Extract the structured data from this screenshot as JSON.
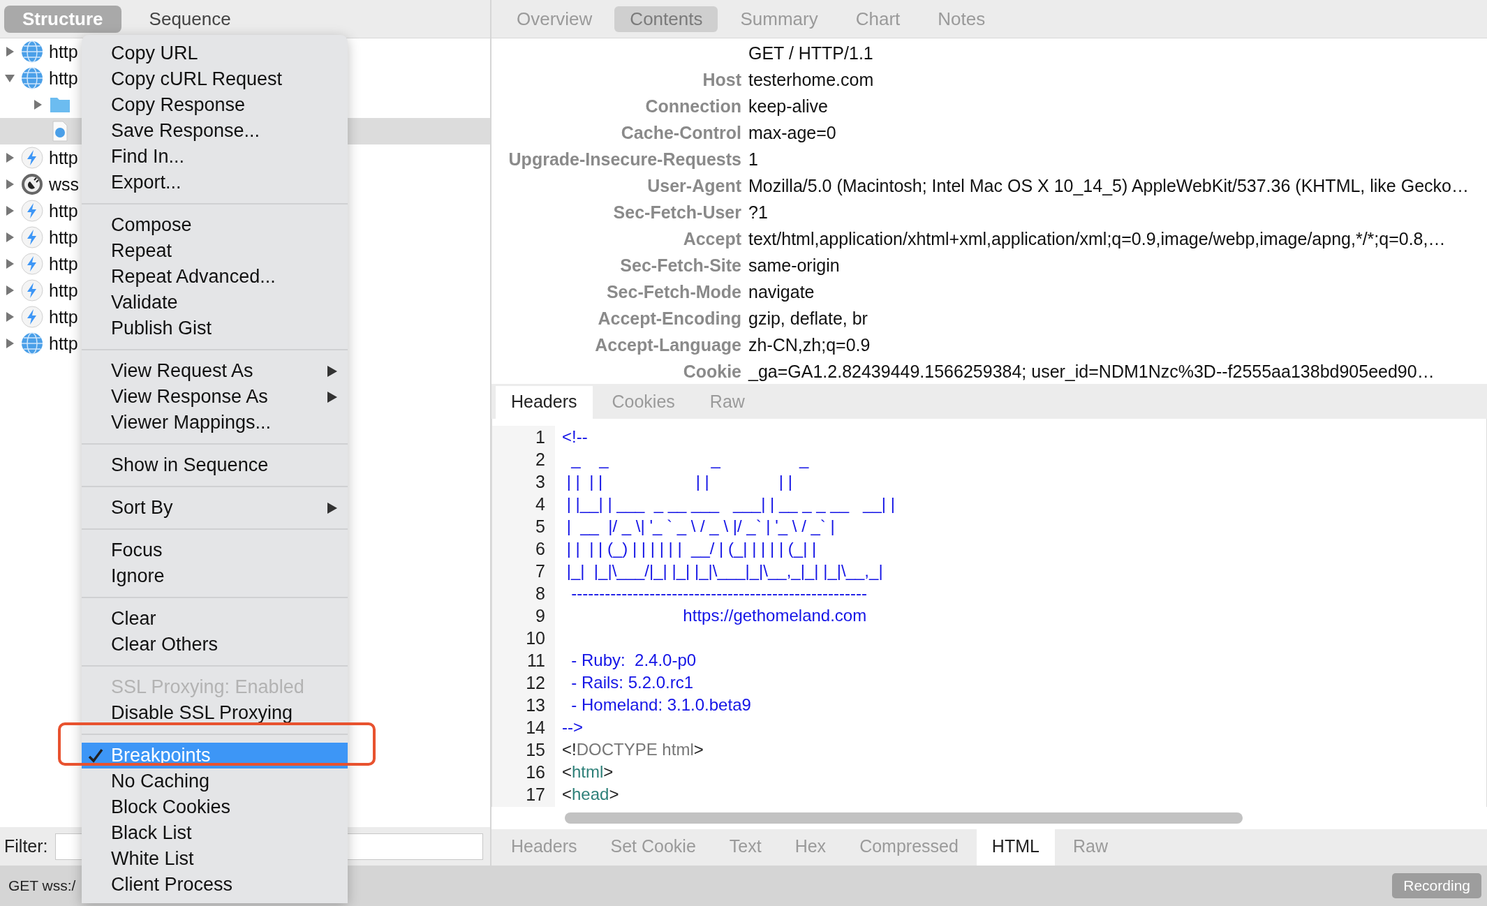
{
  "left_tabs": [
    {
      "label": "Structure",
      "selected": true
    },
    {
      "label": "Sequence",
      "selected": false
    }
  ],
  "tree": [
    {
      "kind": "globe",
      "label": "http",
      "expanded": false,
      "selected": false
    },
    {
      "kind": "globe",
      "label": "http",
      "expanded": true,
      "selected": false,
      "children": [
        {
          "kind": "folder",
          "expanded": false,
          "selected": false
        },
        {
          "kind": "document",
          "selected": true
        }
      ]
    },
    {
      "kind": "bolt",
      "label": "http",
      "expanded": false,
      "selected": false
    },
    {
      "kind": "socket",
      "label": "wss",
      "expanded": false,
      "selected": false
    },
    {
      "kind": "bolt",
      "label": "http",
      "expanded": false,
      "selected": false
    },
    {
      "kind": "bolt",
      "label": "http",
      "expanded": false,
      "selected": false
    },
    {
      "kind": "bolt",
      "label": "http",
      "expanded": false,
      "selected": false
    },
    {
      "kind": "bolt",
      "label": "http",
      "expanded": false,
      "selected": false
    },
    {
      "kind": "bolt",
      "label": "http",
      "expanded": false,
      "selected": false
    },
    {
      "kind": "globe",
      "label": "http",
      "expanded": false,
      "selected": false
    }
  ],
  "filter": {
    "label": "Filter:"
  },
  "context_menu": {
    "sections": [
      [
        {
          "label": "Copy URL"
        },
        {
          "label": "Copy cURL Request"
        },
        {
          "label": "Copy Response"
        },
        {
          "label": "Save Response..."
        },
        {
          "label": "Find In..."
        },
        {
          "label": "Export..."
        }
      ],
      [
        {
          "label": "Compose"
        },
        {
          "label": "Repeat"
        },
        {
          "label": "Repeat Advanced..."
        },
        {
          "label": "Validate"
        },
        {
          "label": "Publish Gist"
        }
      ],
      [
        {
          "label": "View Request As",
          "submenu": true
        },
        {
          "label": "View Response As",
          "submenu": true
        },
        {
          "label": "Viewer Mappings..."
        }
      ],
      [
        {
          "label": "Show in Sequence"
        }
      ],
      [
        {
          "label": "Sort By",
          "submenu": true
        }
      ],
      [
        {
          "label": "Focus"
        },
        {
          "label": "Ignore"
        }
      ],
      [
        {
          "label": "Clear"
        },
        {
          "label": "Clear Others"
        }
      ],
      [
        {
          "label": "SSL Proxying: Enabled",
          "disabled": true
        },
        {
          "label": "Disable SSL Proxying"
        }
      ],
      [
        {
          "label": "Breakpoints",
          "checked": true,
          "selected": true,
          "annotated": true
        },
        {
          "label": "No Caching"
        },
        {
          "label": "Block Cookies"
        },
        {
          "label": "Black List"
        },
        {
          "label": "White List"
        },
        {
          "label": "Client Process"
        }
      ]
    ]
  },
  "right_tabs": [
    {
      "label": "Overview",
      "selected": false
    },
    {
      "label": "Contents",
      "selected": true
    },
    {
      "label": "Summary",
      "selected": false
    },
    {
      "label": "Chart",
      "selected": false
    },
    {
      "label": "Notes",
      "selected": false
    }
  ],
  "request_headers": [
    {
      "value": "GET / HTTP/1.1"
    },
    {
      "name": "Host",
      "value": "testerhome.com"
    },
    {
      "name": "Connection",
      "value": "keep-alive"
    },
    {
      "name": "Cache-Control",
      "value": "max-age=0"
    },
    {
      "name": "Upgrade-Insecure-Requests",
      "value": "1"
    },
    {
      "name": "User-Agent",
      "value": "Mozilla/5.0 (Macintosh; Intel Mac OS X 10_14_5) AppleWebKit/537.36 (KHTML, like Gecko…"
    },
    {
      "name": "Sec-Fetch-User",
      "value": "?1"
    },
    {
      "name": "Accept",
      "value": "text/html,application/xhtml+xml,application/xml;q=0.9,image/webp,image/apng,*/*;q=0.8,…"
    },
    {
      "name": "Sec-Fetch-Site",
      "value": "same-origin"
    },
    {
      "name": "Sec-Fetch-Mode",
      "value": "navigate"
    },
    {
      "name": "Accept-Encoding",
      "value": "gzip, deflate, br"
    },
    {
      "name": "Accept-Language",
      "value": "zh-CN,zh;q=0.9"
    },
    {
      "name": "Cookie",
      "value": "_ga=GA1.2.82439449.1566259384; user_id=NDM1Nzc%3D--f2555aa138bd905eed90…"
    }
  ],
  "request_tabs": [
    {
      "label": "Headers",
      "selected": true
    },
    {
      "label": "Cookies",
      "selected": false
    },
    {
      "label": "Raw",
      "selected": false
    }
  ],
  "code_lines": [
    {
      "number": "1",
      "segments": [
        {
          "kind": "comment",
          "text": "<!--"
        }
      ]
    },
    {
      "number": "2",
      "segments": [
        {
          "kind": "comment",
          "text": "  _    _                      _                 _"
        }
      ]
    },
    {
      "number": "3",
      "segments": [
        {
          "kind": "comment",
          "text": " | |  | |                    | |               | |"
        }
      ]
    },
    {
      "number": "4",
      "segments": [
        {
          "kind": "comment",
          "text": " | |__| | ___  _ __ ___   ___| | __ _ _ __   __| |"
        }
      ]
    },
    {
      "number": "5",
      "segments": [
        {
          "kind": "comment",
          "text": " |  __  |/ _ \\| '_ ` _ \\ / _ \\ |/ _` | '_ \\ / _` |"
        }
      ]
    },
    {
      "number": "6",
      "segments": [
        {
          "kind": "comment",
          "text": " | |  | | (_) | | | | | |  __/ | (_| | | | | (_| |"
        }
      ]
    },
    {
      "number": "7",
      "segments": [
        {
          "kind": "comment",
          "text": " |_|  |_|\\___/|_| |_| |_|\\___|_|\\__,_|_| |_|\\__,_|"
        }
      ]
    },
    {
      "number": "8",
      "segments": [
        {
          "kind": "comment",
          "text": "  -----------------------------------------------------"
        }
      ]
    },
    {
      "number": "9",
      "segments": [
        {
          "kind": "comment",
          "text": "                          https://gethomeland.com"
        }
      ]
    },
    {
      "number": "10"
    },
    {
      "number": "11",
      "segments": [
        {
          "kind": "comment",
          "text": "  - Ruby:  2.4.0-p0"
        }
      ]
    },
    {
      "number": "12",
      "segments": [
        {
          "kind": "comment",
          "text": "  - Rails: 5.2.0.rc1"
        }
      ]
    },
    {
      "number": "13",
      "segments": [
        {
          "kind": "comment",
          "text": "  - Homeland: 3.1.0.beta9"
        }
      ]
    },
    {
      "number": "14",
      "segments": [
        {
          "kind": "comment",
          "text": "-->"
        }
      ]
    },
    {
      "number": "15",
      "segments": [
        {
          "kind": "punct",
          "text": "<!"
        },
        {
          "kind": "doctype",
          "text": "DOCTYPE html"
        },
        {
          "kind": "punct",
          "text": ">"
        }
      ]
    },
    {
      "number": "16",
      "segments": [
        {
          "kind": "punct",
          "text": "<"
        },
        {
          "kind": "tag",
          "text": "html"
        },
        {
          "kind": "punct",
          "text": ">"
        }
      ]
    },
    {
      "number": "17",
      "segments": [
        {
          "kind": "punct",
          "text": "<"
        },
        {
          "kind": "tag",
          "text": "head"
        },
        {
          "kind": "punct",
          "text": ">"
        }
      ]
    }
  ],
  "response_tabs": [
    {
      "label": "Headers",
      "selected": false
    },
    {
      "label": "Set Cookie",
      "selected": false
    },
    {
      "label": "Text",
      "selected": false
    },
    {
      "label": "Hex",
      "selected": false
    },
    {
      "label": "Compressed",
      "selected": false
    },
    {
      "label": "HTML",
      "selected": true
    },
    {
      "label": "Raw",
      "selected": false
    }
  ],
  "status_bar": {
    "text": "GET wss:/",
    "recording": "Recording"
  }
}
